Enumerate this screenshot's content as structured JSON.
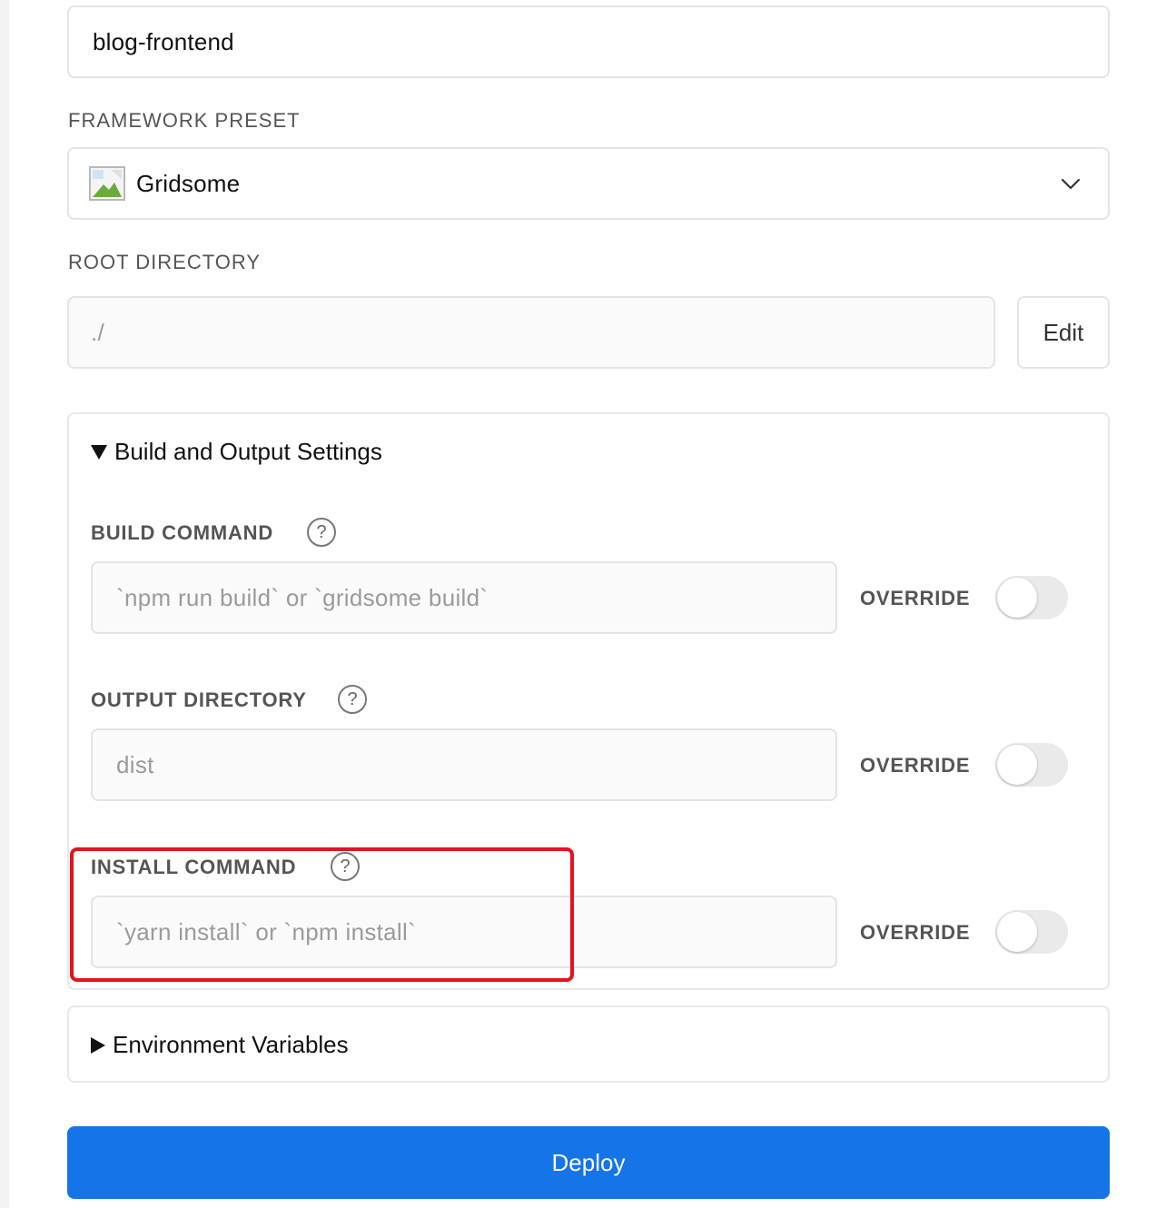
{
  "project_name": {
    "value": "blog-frontend"
  },
  "framework": {
    "label": "FRAMEWORK PRESET",
    "selected": "Gridsome",
    "icon": "broken-image-icon"
  },
  "root_directory": {
    "label": "ROOT DIRECTORY",
    "value": "./",
    "edit_label": "Edit"
  },
  "build_settings": {
    "title": "Build and Output Settings",
    "expanded": true,
    "build_command": {
      "label": "BUILD COMMAND",
      "placeholder": "`npm run build` or `gridsome build`",
      "override_label": "OVERRIDE",
      "override": false
    },
    "output_directory": {
      "label": "OUTPUT DIRECTORY",
      "placeholder": "dist",
      "override_label": "OVERRIDE",
      "override": false
    },
    "install_command": {
      "label": "INSTALL COMMAND",
      "placeholder": "`yarn install` or `npm install`",
      "override_label": "OVERRIDE",
      "override": false
    },
    "help_glyph": "?"
  },
  "env_vars": {
    "title": "Environment Variables",
    "expanded": false
  },
  "deploy": {
    "label": "Deploy"
  },
  "colors": {
    "accent": "#1574e8",
    "highlight": "#e5121f"
  }
}
